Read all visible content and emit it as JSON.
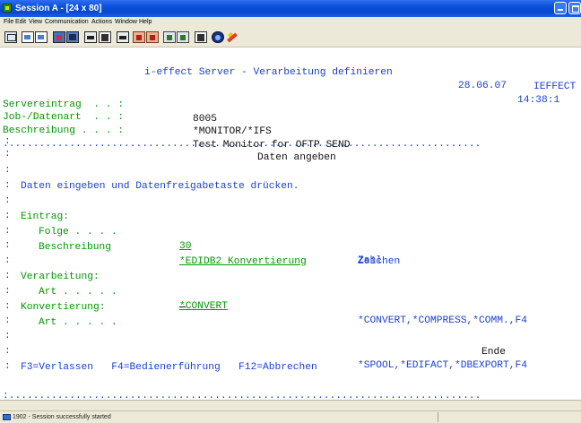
{
  "window": {
    "title": "Session A - [24 x 80]"
  },
  "menu": [
    "File",
    "Edit",
    "View",
    "Communication",
    "Actions",
    "Window",
    "Help"
  ],
  "toolbar": {
    "icons": [
      "print-screen-icon",
      "copy-icon",
      "paste-icon",
      "send-icon",
      "receive-icon",
      "display-icon",
      "keyboard-icon",
      "record-macro-icon",
      "stop-macro-icon",
      "play-macro-icon",
      "settings-icon",
      "connect-icon",
      "disconnect-icon"
    ]
  },
  "screen": {
    "program_title": "i-effect Server - Verarbeitung definieren",
    "program_id": "IEFFECT",
    "date": "28.06.07",
    "time": "14:38:1",
    "servereintrag_label": "Servereintrag  . . :",
    "servereintrag_value": "8005",
    "job_label": "Job-/Datenart  . . :",
    "job_value": "*MONITOR/*IFS",
    "beschreibung_label": "Beschreibung . . . :",
    "beschreibung_value": "Test Monitor for OFTP SEND",
    "popup_border_top": "...............................................................................",
    "popup_border_bottom": ":..............................................................................",
    "popup_title": "Daten angeben",
    "instruction": "Daten eingeben und Datenfreigabetaste drücken.",
    "eintrag_label": "Eintrag:",
    "folge_label": "Folge . . . .",
    "folge_value": "30",
    "folge_hint": "Zahl",
    "beschr_label": "Beschreibung",
    "beschr_value": "*EDIDB2 Konvertierung",
    "beschr_hint": "Zeichen",
    "verarbeitung_label": "Verarbeitung:",
    "art1_label": "Art . . . . .",
    "art1_value": "*CONVERT",
    "art1_hint": "*CONVERT,*COMPRESS,*COMM.,F4",
    "konvertierung_label": "Konvertierung:",
    "art2_label": "Art . . . . .",
    "art2_value": "",
    "art2_hint": "*SPOOL,*EDIFACT,*DBEXPORT,F4",
    "ende": "Ende",
    "fkeys": "F3=Verlassen   F4=Bedienerführung   F12=Abbrechen"
  },
  "status": {
    "text": "1902 - Session successfully started"
  },
  "colors": {
    "green": "#009900",
    "blue": "#1a3fd6",
    "titlebar": "#0a4fd8"
  }
}
